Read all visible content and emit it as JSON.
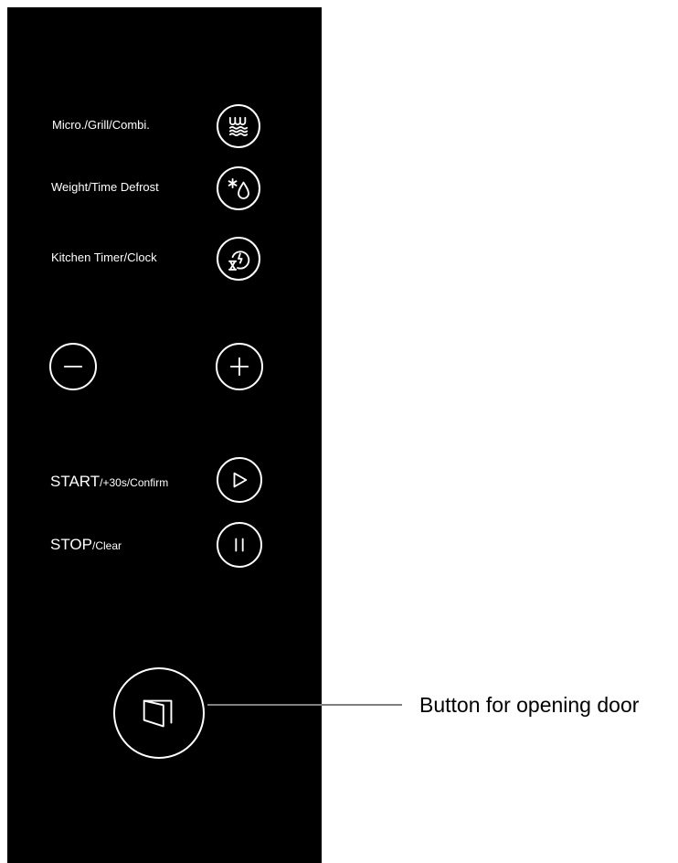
{
  "panel": {
    "mode_label": "Micro./Grill/Combi.",
    "defrost_label": "Weight/Time Defrost",
    "timer_label": "Kitchen Timer/Clock",
    "start_main": "START",
    "start_sub": "/+30s/Confirm",
    "stop_main": "STOP",
    "stop_sub": "/Clear"
  },
  "callout": {
    "text": "Button for opening door"
  },
  "colors": {
    "panel": "#000000",
    "button_outline": "#ffffff",
    "leader_line": "#808080"
  },
  "icons": [
    "microwave-grill-icon",
    "defrost-icon",
    "timer-clock-icon",
    "minus-icon",
    "plus-icon",
    "play-icon",
    "pause-icon",
    "door-open-icon"
  ]
}
